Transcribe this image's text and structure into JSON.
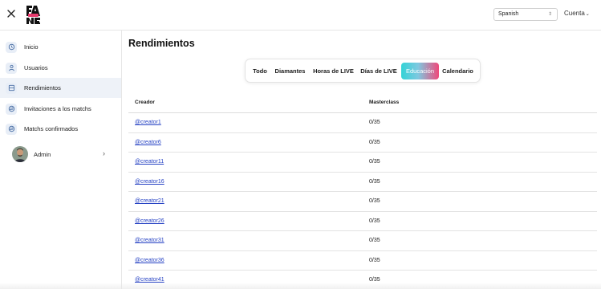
{
  "header": {
    "language_value": "Spanish",
    "account_label": "Cuenta"
  },
  "sidebar": {
    "items": [
      {
        "label": "Inicio",
        "icon": "home-icon"
      },
      {
        "label": "Usuarios",
        "icon": "user-icon"
      },
      {
        "label": "Rendimientos",
        "icon": "report-icon",
        "active": true
      },
      {
        "label": "Invitaciones a los matchs",
        "icon": "match-icon"
      },
      {
        "label": "Matchs confirmados",
        "icon": "match-confirmed-icon"
      }
    ],
    "admin": {
      "label": "Admin"
    }
  },
  "main": {
    "title": "Rendimientos",
    "tabs": [
      {
        "label": "Todo"
      },
      {
        "label": "Diamantes"
      },
      {
        "label": "Horas de LIVE"
      },
      {
        "label": "Días de LIVE"
      },
      {
        "label": "Educación",
        "active": true
      },
      {
        "label": "Calendario"
      }
    ],
    "table": {
      "columns": [
        "Creador",
        "Masterclass"
      ],
      "rows": [
        {
          "creator": "@creator1",
          "masterclass": "0/35"
        },
        {
          "creator": "@creator6",
          "masterclass": "0/35"
        },
        {
          "creator": "@creator11",
          "masterclass": "0/35"
        },
        {
          "creator": "@creator16",
          "masterclass": "0/35"
        },
        {
          "creator": "@creator21",
          "masterclass": "0/35"
        },
        {
          "creator": "@creator26",
          "masterclass": "0/35"
        },
        {
          "creator": "@creator31",
          "masterclass": "0/35"
        },
        {
          "creator": "@creator36",
          "masterclass": "0/35"
        },
        {
          "creator": "@creator41",
          "masterclass": "0/35"
        }
      ]
    }
  },
  "colors": {
    "link": "#2743c4",
    "active_nav_bg": "#eef2f8",
    "tab_gradient_start": "#33d3d6",
    "tab_gradient_end": "#f0497a"
  }
}
